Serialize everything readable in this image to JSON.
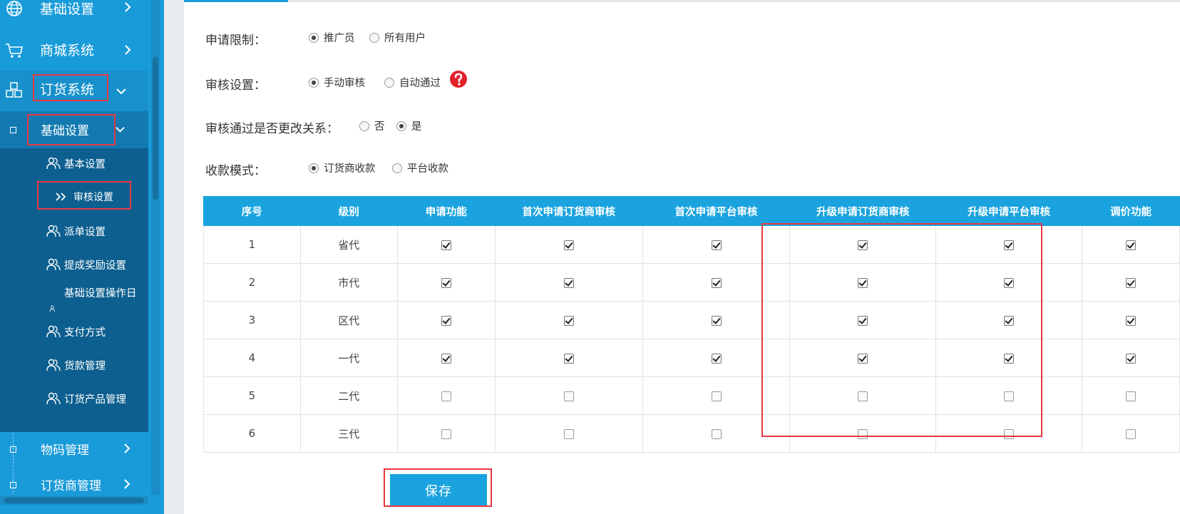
{
  "sidebar": {
    "menu": [
      {
        "label": "基础设置",
        "icon": "globe-icon"
      },
      {
        "label": "商城系统",
        "icon": "cart-icon"
      },
      {
        "label": "订货系统",
        "icon": "cubes-icon"
      }
    ],
    "submenu_title": "基础设置",
    "sub_items": [
      {
        "label": "基本设置",
        "icon": "users-icon"
      },
      {
        "label": "审核设置",
        "icon": "double-chevron-right-icon"
      },
      {
        "label": "派单设置",
        "icon": "users-icon"
      },
      {
        "label": "提成奖励设置",
        "icon": "users-icon"
      },
      {
        "label": "基础设置操作日",
        "icon": "users-icon"
      },
      {
        "label": "支付方式",
        "icon": "users-icon"
      },
      {
        "label": "货款管理",
        "icon": "users-icon"
      },
      {
        "label": "订货产品管理",
        "icon": "users-icon"
      }
    ],
    "bottom_items": [
      {
        "label": "物码管理"
      },
      {
        "label": "订货商管理"
      }
    ]
  },
  "form": {
    "apply_limit": {
      "label": "申请限制：",
      "options": [
        "推广员",
        "所有用户"
      ],
      "selected": "推广员"
    },
    "review_setting": {
      "label": "审核设置：",
      "options": [
        "手动审核",
        "自动通过"
      ],
      "selected": "手动审核"
    },
    "change_relation": {
      "label": "审核通过是否更改关系：",
      "options": [
        "否",
        "是"
      ],
      "selected": "是"
    },
    "payment_mode": {
      "label": "收款模式：",
      "options": [
        "订货商收款",
        "平台收款"
      ],
      "selected": "订货商收款"
    }
  },
  "table": {
    "headers": [
      "序号",
      "级别",
      "申请功能",
      "首次申请订货商审核",
      "首次申请平台审核",
      "升级申请订货商审核",
      "升级申请平台审核",
      "调价功能"
    ],
    "rows": [
      {
        "no": "1",
        "level": "省代",
        "checks": [
          true,
          true,
          true,
          true,
          true,
          true
        ]
      },
      {
        "no": "2",
        "level": "市代",
        "checks": [
          true,
          true,
          true,
          true,
          true,
          true
        ]
      },
      {
        "no": "3",
        "level": "区代",
        "checks": [
          true,
          true,
          true,
          true,
          true,
          true
        ]
      },
      {
        "no": "4",
        "level": "一代",
        "checks": [
          true,
          true,
          true,
          true,
          true,
          true
        ]
      },
      {
        "no": "5",
        "level": "二代",
        "checks": [
          false,
          false,
          false,
          false,
          false,
          false
        ]
      },
      {
        "no": "6",
        "level": "三代",
        "checks": [
          false,
          false,
          false,
          false,
          false,
          false
        ]
      }
    ]
  },
  "save_label": "保存",
  "colors": {
    "sidebar": "#1a9bd9",
    "submenu": "#0d5f8f",
    "header": "#1aa3de",
    "annotation": "#e8383f"
  }
}
